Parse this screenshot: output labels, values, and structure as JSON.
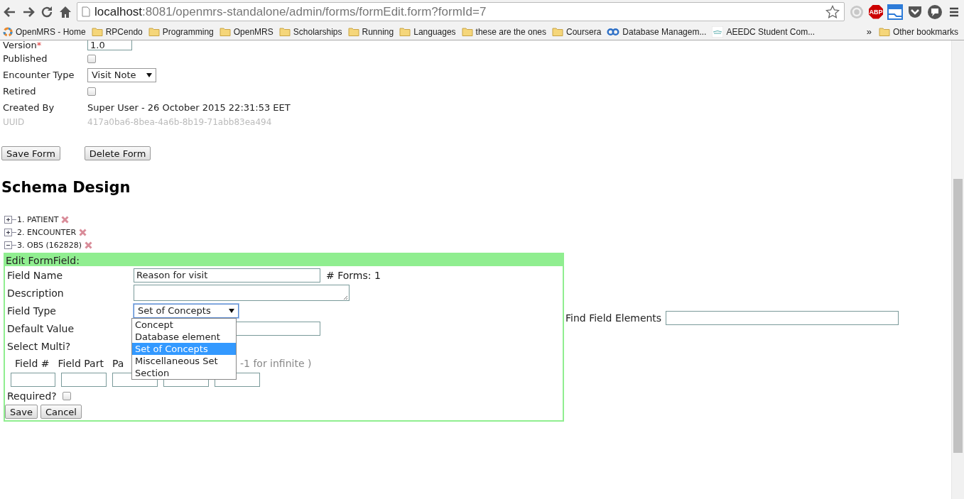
{
  "browser": {
    "url_host": "localhost",
    "url_path": ":8081/openmrs-standalone/admin/forms/formEdit.form?formId=7",
    "adblock_label": "ABP",
    "bookmarks": [
      {
        "label": "OpenMRS - Home",
        "kind": "site"
      },
      {
        "label": "RPCendo",
        "kind": "folder"
      },
      {
        "label": "Programming",
        "kind": "folder"
      },
      {
        "label": "OpenMRS",
        "kind": "folder"
      },
      {
        "label": "Scholarships",
        "kind": "folder"
      },
      {
        "label": "Running",
        "kind": "folder"
      },
      {
        "label": "Languages",
        "kind": "folder"
      },
      {
        "label": "these are the ones",
        "kind": "folder"
      },
      {
        "label": "Coursera",
        "kind": "folder"
      },
      {
        "label": "Database Managem...",
        "kind": "link"
      },
      {
        "label": "AEEDC Student Com...",
        "kind": "image"
      }
    ],
    "overflow": "»",
    "other_bookmarks": "Other bookmarks"
  },
  "form": {
    "rows": [
      {
        "kind": "input",
        "label": "Version",
        "marker": "*",
        "value": "1.0"
      },
      {
        "kind": "checkbox",
        "label": "Published",
        "checked": false
      },
      {
        "kind": "select",
        "label": "Encounter Type",
        "value": "Visit Note"
      },
      {
        "kind": "checkbox",
        "label": "Retired",
        "checked": false
      },
      {
        "kind": "text",
        "label": "Created By",
        "value": "Super User - 26 October 2015 22:31:53 EET"
      },
      {
        "kind": "muted",
        "label": "UUID",
        "value": "417a0ba6-8bea-4a6b-8b19-71abb83ea494"
      }
    ],
    "buttons": [
      "Save Form",
      "Delete Form"
    ]
  },
  "schema": {
    "title": "Schema Design",
    "tree": [
      {
        "label": "1. PATIENT",
        "expanded": false
      },
      {
        "label": "2. ENCOUNTER",
        "expanded": false
      },
      {
        "label": "3. OBS (162828)",
        "expanded": true
      }
    ],
    "find_label": "Find Field Elements",
    "editor": {
      "title": "Edit FormField:",
      "field_name": {
        "label": "Field Name",
        "value": "Reason for visit"
      },
      "forms_count": "# Forms: 1",
      "description": {
        "label": "Description"
      },
      "field_type": {
        "label": "Field Type",
        "value": "Set of Concepts",
        "expanded": true,
        "options": [
          {
            "label": "Concept",
            "selected": false
          },
          {
            "label": "Database element",
            "selected": false
          },
          {
            "label": "Set of Concepts",
            "selected": true
          },
          {
            "label": "Miscellaneous Set",
            "selected": false
          },
          {
            "label": "Section",
            "selected": false
          }
        ]
      },
      "default_value": {
        "label": "Default Value"
      },
      "select_multi": {
        "label": "Select Multi?"
      },
      "columns": [
        "Field #",
        "Field Part",
        "Pa"
      ],
      "hint": "-1 for infinite )",
      "required": {
        "label": "Required?",
        "checked": false
      },
      "buttons": [
        "Save",
        "Cancel"
      ]
    }
  }
}
